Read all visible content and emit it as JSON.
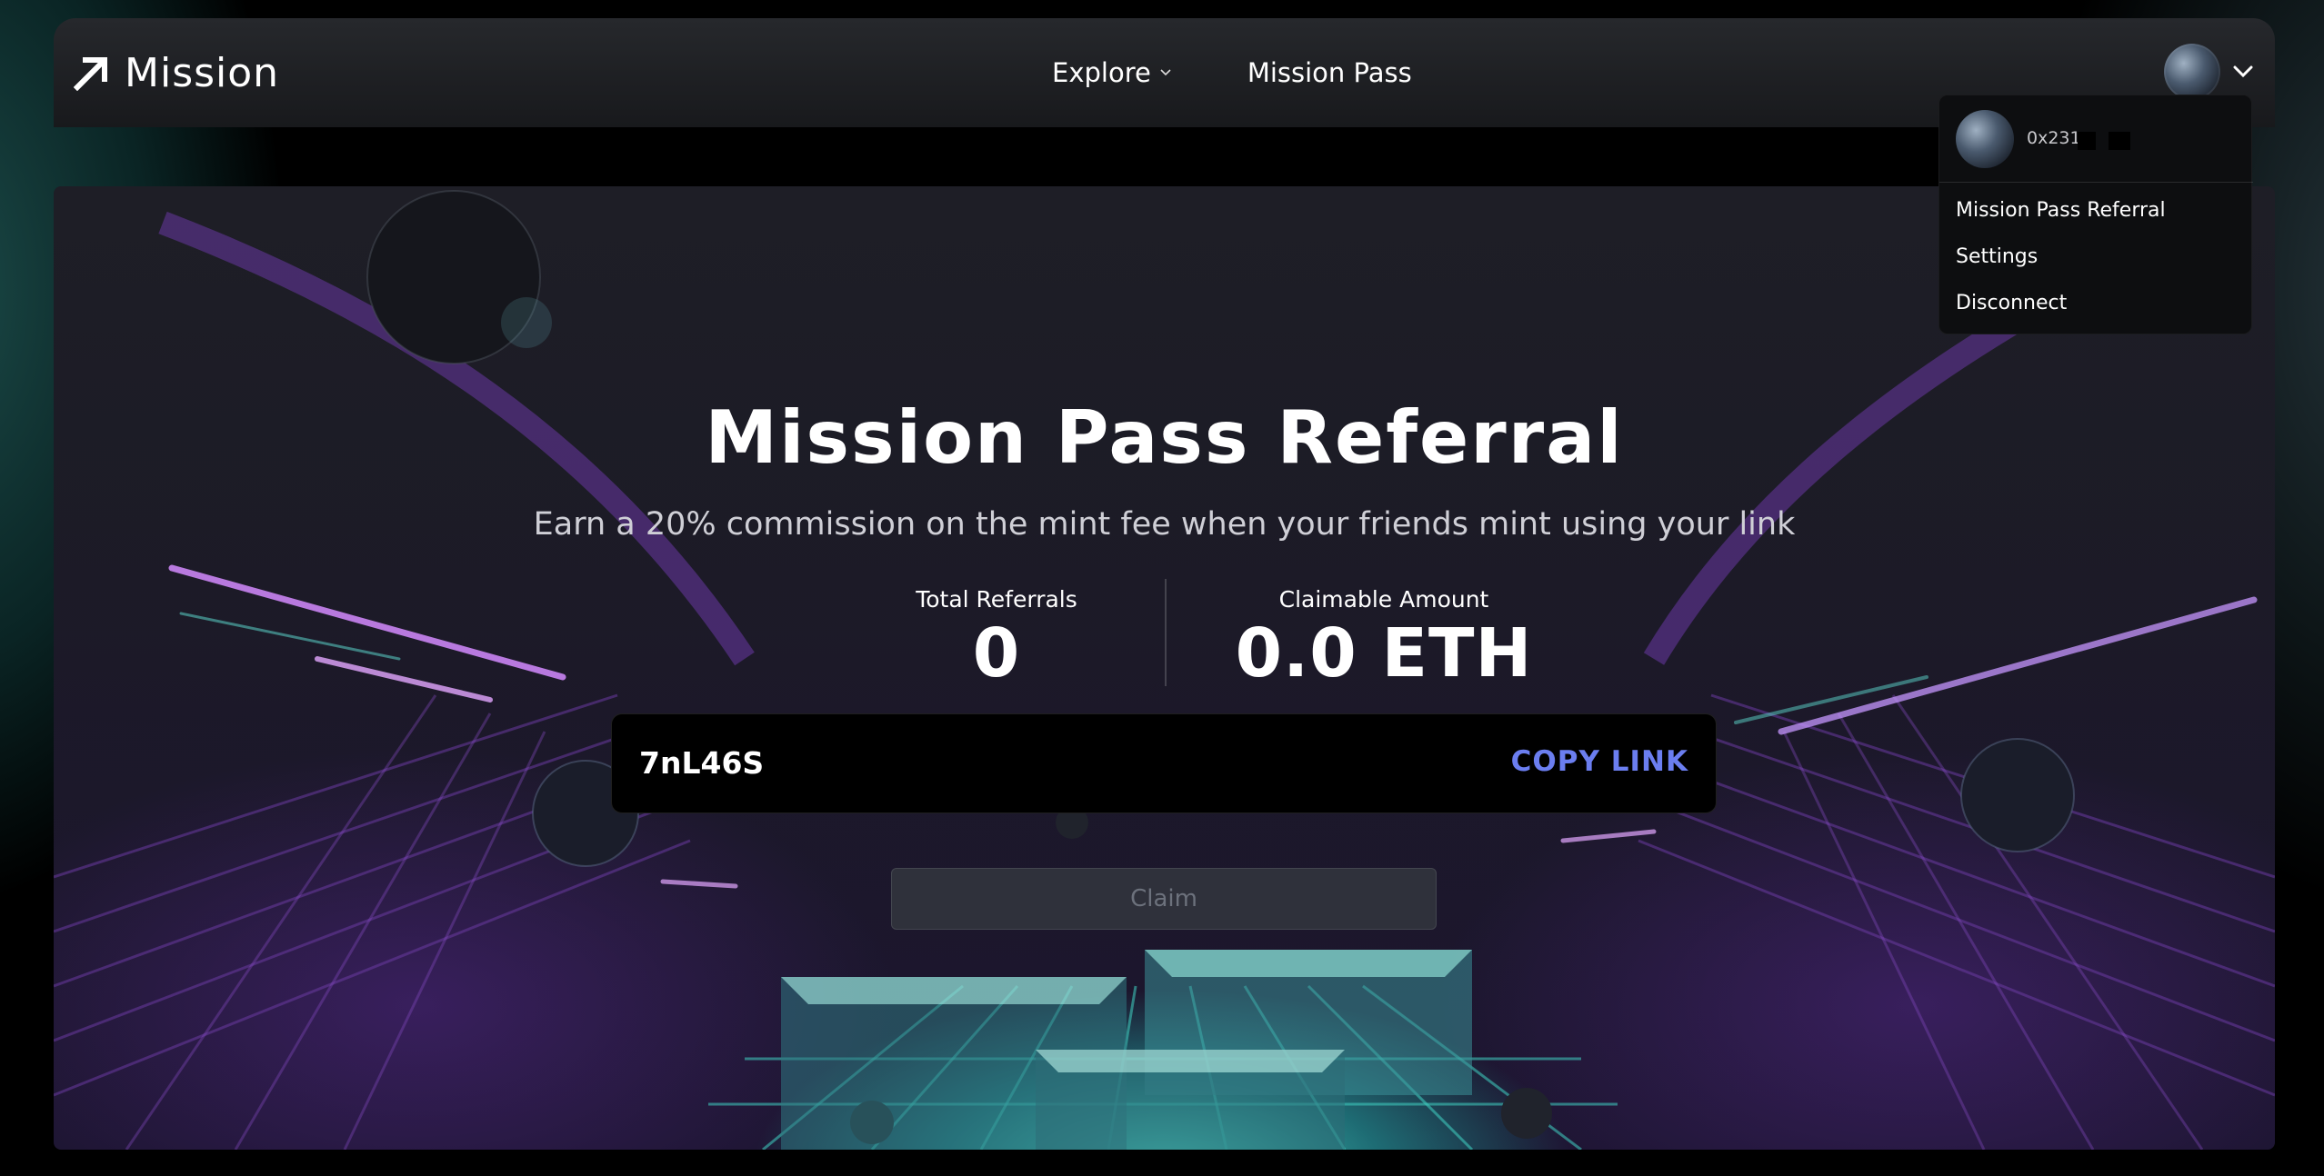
{
  "nav": {
    "brand": "Mission",
    "links": [
      {
        "label": "Explore"
      },
      {
        "label": "Mission Pass"
      }
    ]
  },
  "hero": {
    "title": "Mission Pass Referral",
    "subtitle": "Earn a 20% commission on the mint fee when your friends mint using your link",
    "stats": [
      {
        "label": "Total Referrals",
        "value": "0"
      },
      {
        "label": "Claimable Amount",
        "value": "0.0 ETH"
      }
    ],
    "referral_code": "7nL46S",
    "copy_label": "COPY LINK",
    "claim_label": "Claim"
  },
  "dropdown": {
    "address": "0x231",
    "items": [
      {
        "label": "Mission Pass Referral"
      },
      {
        "label": "Settings"
      },
      {
        "label": "Disconnect"
      }
    ]
  },
  "colors": {
    "accent": "#6b7ef0",
    "nav_bg": "#1f2124",
    "page_bg": "#000000"
  },
  "icons": [
    "logo-arrow-icon",
    "chevron-down-icon",
    "avatar"
  ]
}
